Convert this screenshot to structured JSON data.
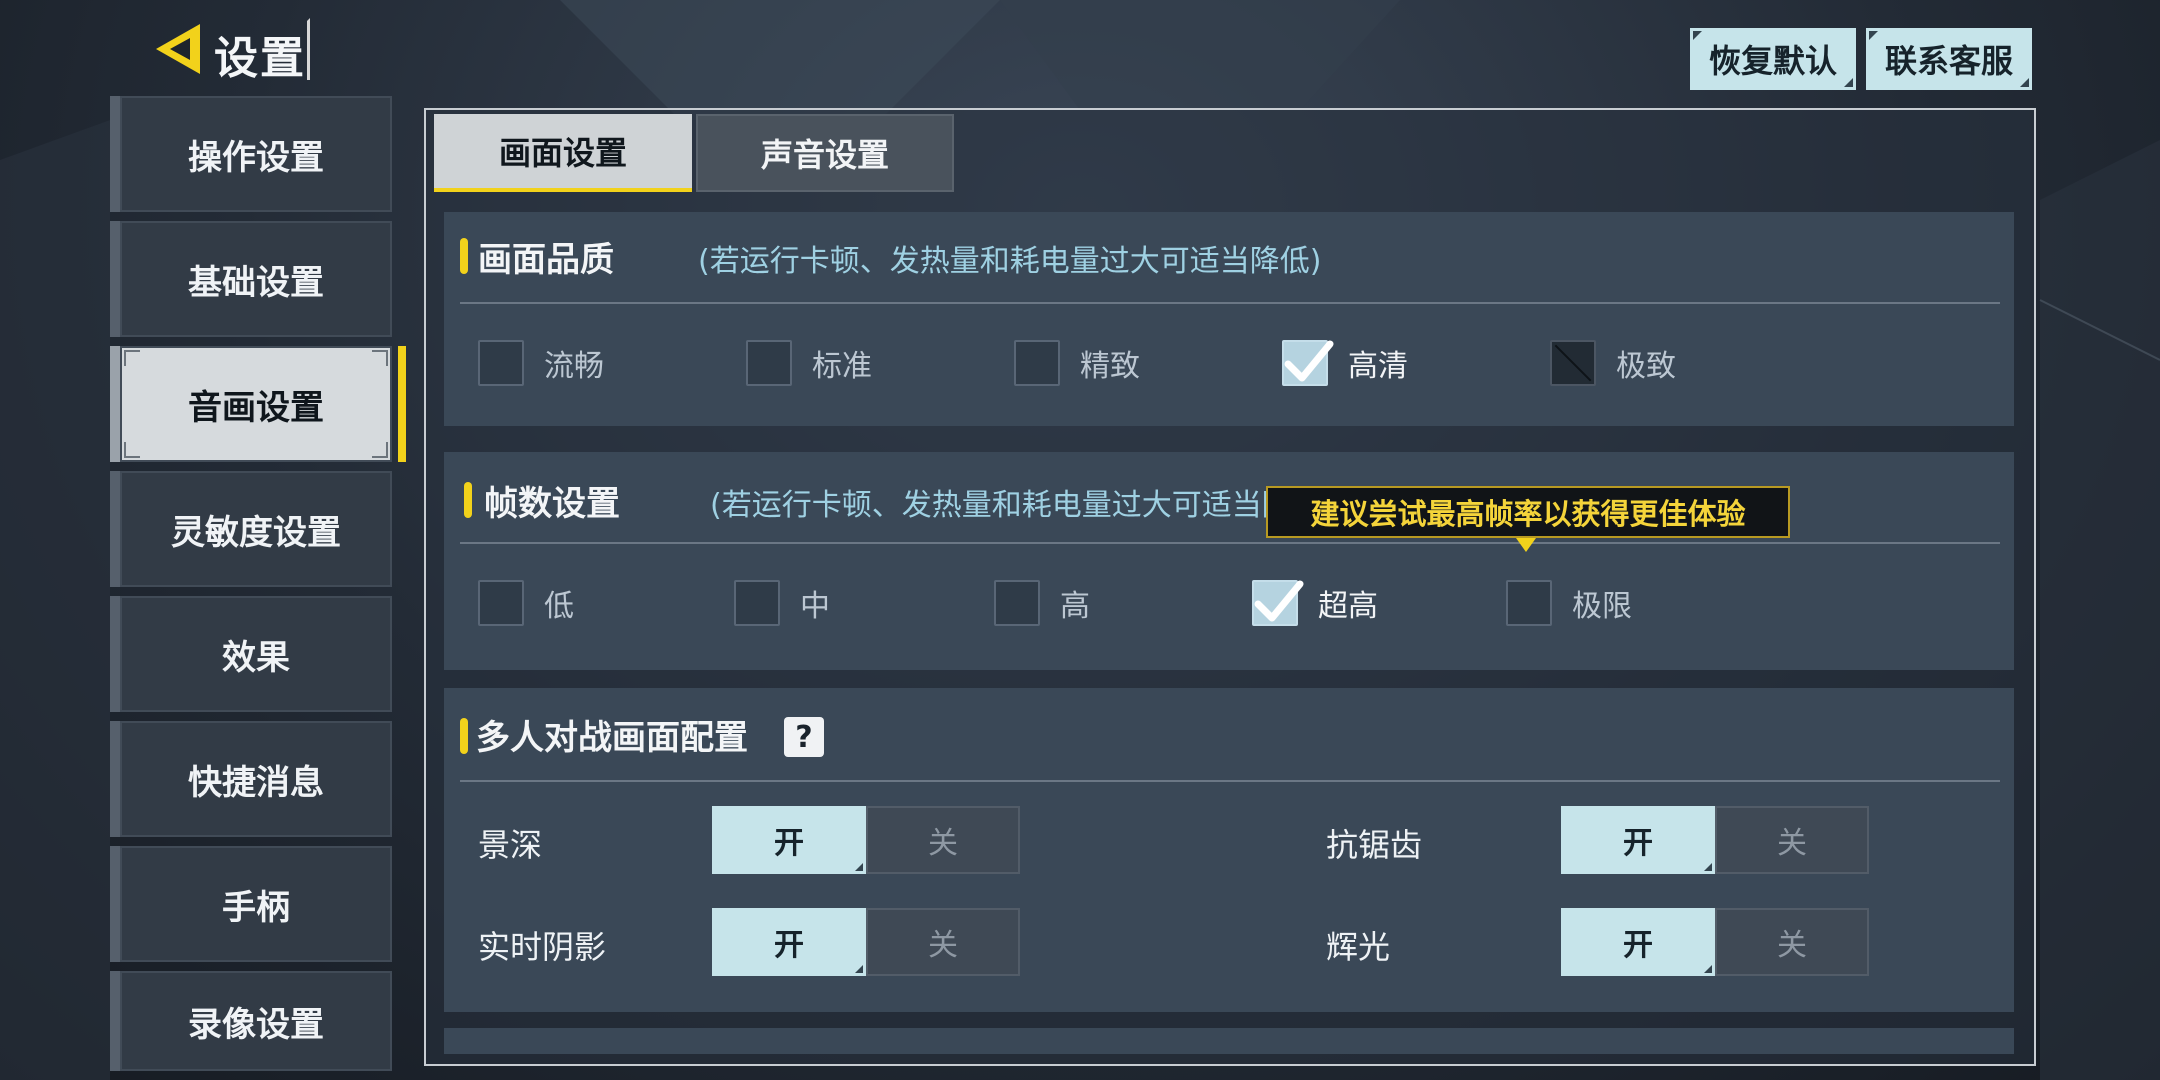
{
  "header": {
    "title": "设置",
    "restore_label": "恢复默认",
    "contact_label": "联系客服"
  },
  "sidebar": {
    "items": [
      {
        "label": "操作设置"
      },
      {
        "label": "基础设置"
      },
      {
        "label": "音画设置"
      },
      {
        "label": "灵敏度设置"
      },
      {
        "label": "效果"
      },
      {
        "label": "快捷消息"
      },
      {
        "label": "手柄"
      },
      {
        "label": "录像设置"
      }
    ],
    "active_index": 2
  },
  "tabs": [
    {
      "label": "画面设置"
    },
    {
      "label": "声音设置"
    }
  ],
  "quality": {
    "title": "画面品质",
    "hint": "(若运行卡顿、发热量和耗电量过大可适当降低)",
    "options": [
      "流畅",
      "标准",
      "精致",
      "高清",
      "极致"
    ],
    "selected": "高清",
    "disabled": "极致"
  },
  "framerate": {
    "title": "帧数设置",
    "hint": "(若运行卡顿、发热量和耗电量过大可适当降低)",
    "options": [
      "低",
      "中",
      "高",
      "超高",
      "极限"
    ],
    "selected": "超高",
    "tooltip": "建议尝试最高帧率以获得更佳体验"
  },
  "multiplayer": {
    "title": "多人对战画面配置",
    "help": "?",
    "on_label": "开",
    "off_label": "关",
    "settings": [
      {
        "label": "景深",
        "value": "开"
      },
      {
        "label": "抗锯齿",
        "value": "开"
      },
      {
        "label": "实时阴影",
        "value": "开"
      },
      {
        "label": "辉光",
        "value": "开"
      }
    ]
  },
  "colors": {
    "accent": "#f2d21b",
    "button_bg": "#c6e4ea",
    "hint_text": "#9fd1e3"
  }
}
